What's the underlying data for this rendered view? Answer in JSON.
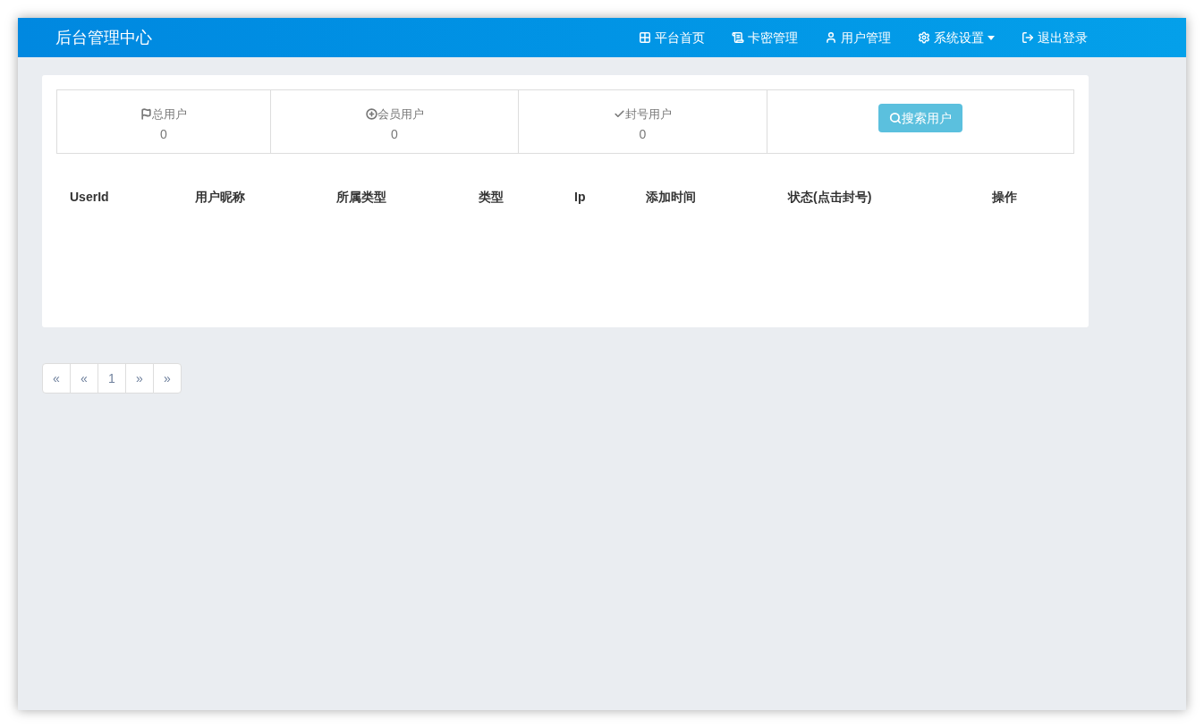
{
  "navbar": {
    "brand": "后台管理中心",
    "items": [
      {
        "label": "平台首页",
        "dropdown": false
      },
      {
        "label": "卡密管理",
        "dropdown": false
      },
      {
        "label": "用户管理",
        "dropdown": false
      },
      {
        "label": "系统设置",
        "dropdown": true
      },
      {
        "label": "退出登录",
        "dropdown": false
      }
    ]
  },
  "stats": [
    {
      "label": "总用户",
      "value": "0"
    },
    {
      "label": "会员用户",
      "value": "0"
    },
    {
      "label": "封号用户",
      "value": "0"
    }
  ],
  "search_button": {
    "label": "搜索用户"
  },
  "table": {
    "columns": [
      "UserId",
      "用户昵称",
      "所属类型",
      "类型",
      "Ip",
      "添加时间",
      "状态(点击封号)",
      "操作"
    ]
  },
  "pagination": [
    "«",
    "«",
    "1",
    "»",
    "»"
  ]
}
